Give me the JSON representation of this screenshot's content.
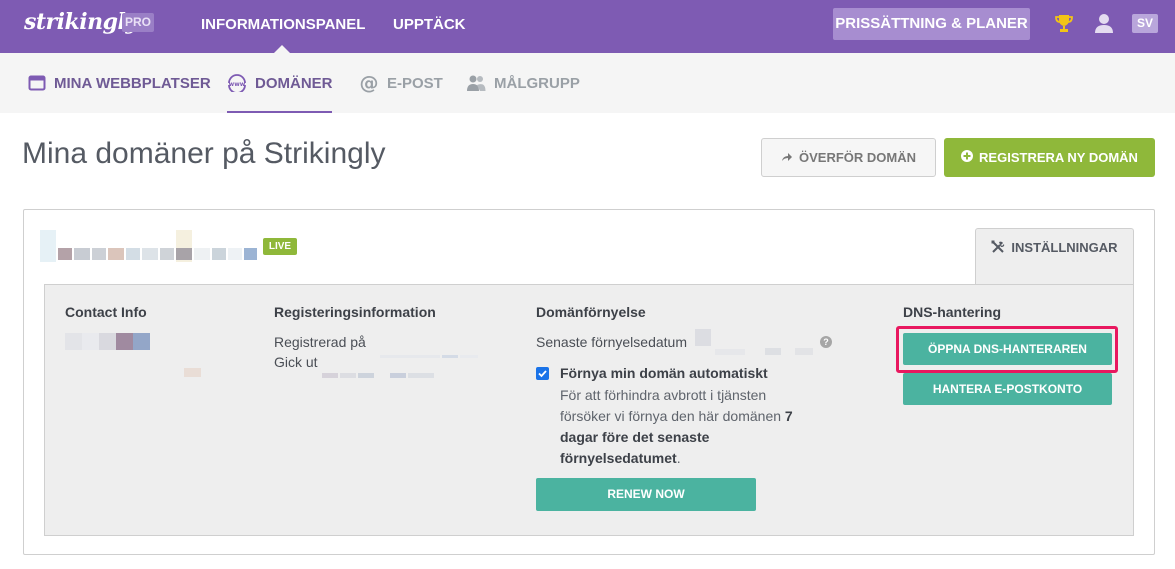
{
  "topbar": {
    "logo": "strikingly",
    "pro_badge": "PRO",
    "nav": [
      "INFORMATIONSPANEL",
      "UPPTÄCK"
    ],
    "pricing_button": "PRISSÄTTNING & PLANER",
    "trophy_icon": "trophy-icon",
    "user_icon": "user-icon",
    "language": "SV"
  },
  "subnav": {
    "items": [
      {
        "label": "MINA WEBBPLATSER",
        "icon": "browser-window-icon"
      },
      {
        "label": "DOMÄNER",
        "icon": "www-globe-icon"
      },
      {
        "label": "E-POST",
        "icon": "at-sign-icon"
      },
      {
        "label": "MÅLGRUPP",
        "icon": "people-icon"
      }
    ],
    "active_index": 1
  },
  "page": {
    "title": "Mina domäner på Strikingly",
    "transfer_button": "ÖVERFÖR DOMÄN",
    "register_button": "REGISTRERA NY DOMÄN"
  },
  "domain_card": {
    "status_badge": "LIVE",
    "settings_tab": "INSTÄLLNINGAR",
    "contact": {
      "heading": "Contact Info"
    },
    "registration": {
      "heading": "Registeringsinformation",
      "registered_label": "Registrerad på",
      "expires_label": "Gick ut"
    },
    "renewal": {
      "heading": "Domänförnyelse",
      "latest_date_label": "Senaste förnyelsedatum",
      "auto_renew_label": "Förnya min domän automatiskt",
      "auto_renew_checked": true,
      "desc_part1": "För att förhindra avbrott i tjänsten försöker vi förnya den här domänen ",
      "desc_bold": "7 dagar före det senaste förnyelsedatumet",
      "desc_end": ".",
      "renew_button": "RENEW NOW"
    },
    "dns": {
      "heading": "DNS-hantering",
      "open_dns_button": "ÖPPNA DNS-HANTERAREN",
      "manage_email_button": "HANTERA E-POSTKONTO"
    }
  },
  "colors": {
    "brand_purple": "#7e5bb3",
    "green": "#8fb83a",
    "teal": "#4bb3a0",
    "highlight": "#e8185f"
  }
}
